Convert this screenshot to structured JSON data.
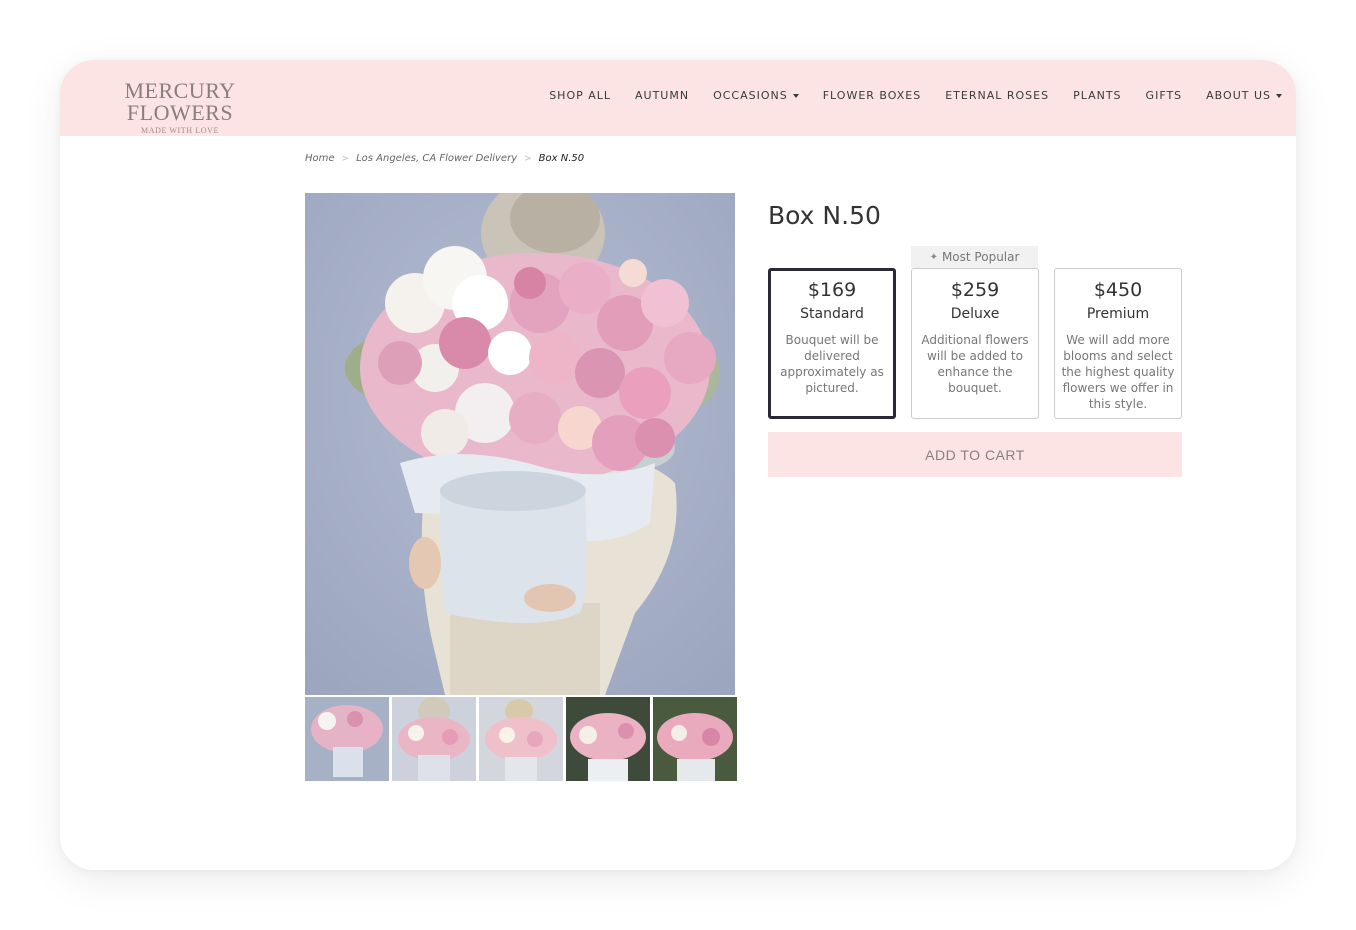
{
  "brand": {
    "name": "MERCURY FLOWERS",
    "tagline": "MADE WITH LOVE"
  },
  "nav": {
    "items": [
      {
        "label": "SHOP ALL",
        "dropdown": false
      },
      {
        "label": "AUTUMN",
        "dropdown": false
      },
      {
        "label": "OCCASIONS",
        "dropdown": true
      },
      {
        "label": "FLOWER BOXES",
        "dropdown": false
      },
      {
        "label": "ETERNAL ROSES",
        "dropdown": false
      },
      {
        "label": "PLANTS",
        "dropdown": false
      },
      {
        "label": "GIFTS",
        "dropdown": false
      },
      {
        "label": "ABOUT US",
        "dropdown": true
      }
    ]
  },
  "breadcrumb": {
    "home": "Home",
    "category": "Los Angeles, CA Flower Delivery",
    "current": "Box N.50",
    "separator": ">"
  },
  "product": {
    "title": "Box N.50",
    "popular_badge": "Most Popular",
    "options": [
      {
        "price": "$169",
        "name": "Standard",
        "description": "Bouquet will be delivered approximately as pictured.",
        "selected": true
      },
      {
        "price": "$259",
        "name": "Deluxe",
        "description": "Additional flowers will be added to enhance the bouquet.",
        "selected": false
      },
      {
        "price": "$450",
        "name": "Premium",
        "description": "We will add more blooms and select the highest quality flowers we offer in this style.",
        "selected": false
      }
    ],
    "add_to_cart_label": "ADD TO CART"
  },
  "gallery": {
    "main_image": "bouquet-in-hatbox-held-by-woman",
    "thumbnails": [
      "thumb-1",
      "thumb-2",
      "thumb-3",
      "thumb-4",
      "thumb-5"
    ]
  },
  "colors": {
    "header_bg": "#fce4e4",
    "button_bg": "#fce4e4",
    "selected_border": "#2a2a35"
  }
}
